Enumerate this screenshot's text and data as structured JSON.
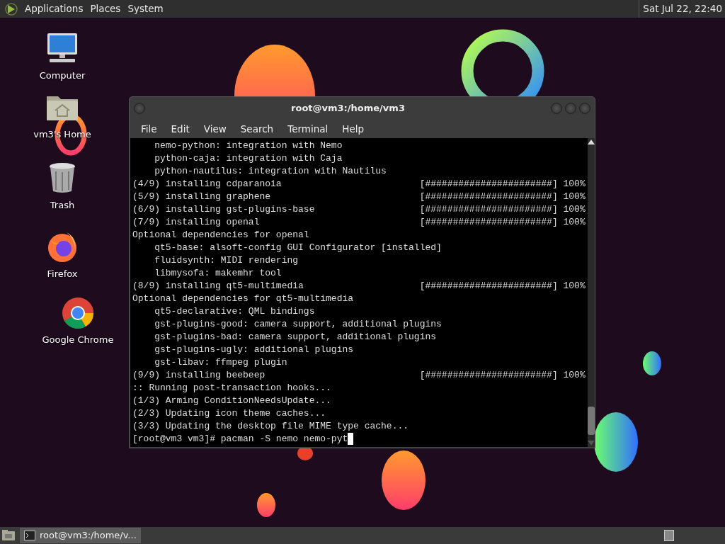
{
  "top_panel": {
    "menus": [
      "Applications",
      "Places",
      "System"
    ],
    "clock": "Sat Jul 22, 22:40"
  },
  "desktop_icons": [
    {
      "label": "Computer",
      "kind": "computer"
    },
    {
      "label": "vm3's Home",
      "kind": "home"
    },
    {
      "label": "Trash",
      "kind": "trash"
    },
    {
      "label": "Firefox",
      "kind": "firefox"
    },
    {
      "label": "Google Chrome",
      "kind": "chrome"
    }
  ],
  "terminal": {
    "title": "root@vm3:/home/vm3",
    "menus": [
      "File",
      "Edit",
      "View",
      "Search",
      "Terminal",
      "Help"
    ],
    "lines": [
      {
        "text": "    nemo-python: integration with Nemo"
      },
      {
        "text": "    python-caja: integration with Caja"
      },
      {
        "text": "    python-nautilus: integration with Nautilus"
      },
      {
        "text": "(4/9) installing cdparanoia",
        "progress": "[#######################] 100%"
      },
      {
        "text": "(5/9) installing graphene",
        "progress": "[#######################] 100%"
      },
      {
        "text": "(6/9) installing gst-plugins-base",
        "progress": "[#######################] 100%"
      },
      {
        "text": "(7/9) installing openal",
        "progress": "[#######################] 100%"
      },
      {
        "text": "Optional dependencies for openal"
      },
      {
        "text": "    qt5-base: alsoft-config GUI Configurator [installed]"
      },
      {
        "text": "    fluidsynth: MIDI rendering"
      },
      {
        "text": "    libmysofa: makemhr tool"
      },
      {
        "text": "(8/9) installing qt5-multimedia",
        "progress": "[#######################] 100%"
      },
      {
        "text": "Optional dependencies for qt5-multimedia"
      },
      {
        "text": "    qt5-declarative: QML bindings"
      },
      {
        "text": "    gst-plugins-good: camera support, additional plugins"
      },
      {
        "text": "    gst-plugins-bad: camera support, additional plugins"
      },
      {
        "text": "    gst-plugins-ugly: additional plugins"
      },
      {
        "text": "    gst-libav: ffmpeg plugin"
      },
      {
        "text": "(9/9) installing beebeep",
        "progress": "[#######################] 100%"
      },
      {
        "text": ":: Running post-transaction hooks..."
      },
      {
        "text": "(1/3) Arming ConditionNeedsUpdate..."
      },
      {
        "text": "(2/3) Updating icon theme caches..."
      },
      {
        "text": "(3/3) Updating the desktop file MIME type cache..."
      }
    ],
    "prompt": "[root@vm3 vm3]# pacman -S nemo nemo-pyt"
  },
  "taskbar": {
    "tasks": [
      {
        "label": "root@vm3:/home/v...",
        "selected": true
      }
    ]
  }
}
